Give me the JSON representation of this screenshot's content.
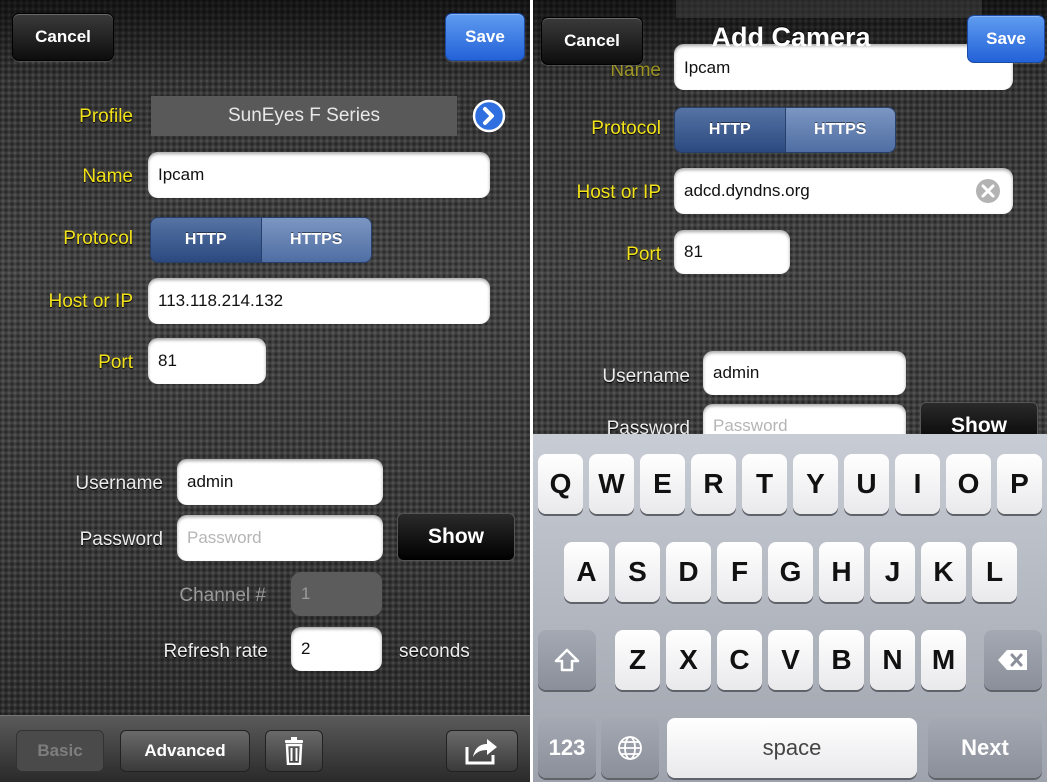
{
  "left": {
    "nav": {
      "cancel": "Cancel",
      "save": "Save"
    },
    "labels": {
      "profile": "Profile",
      "name": "Name",
      "protocol": "Protocol",
      "host": "Host or IP",
      "port": "Port",
      "username": "Username",
      "password": "Password",
      "channel": "Channel #",
      "refresh": "Refresh rate",
      "seconds": "seconds"
    },
    "profile_value": "SunEyes F Series",
    "name_value": "Ipcam",
    "protocol_options": [
      "HTTP",
      "HTTPS"
    ],
    "host_value": "113.118.214.132",
    "port_value": "81",
    "username_value": "admin",
    "password_placeholder": "Password",
    "show_button": "Show",
    "channel_value": "1",
    "refresh_value": "2",
    "toolbar": {
      "basic": "Basic",
      "advanced": "Advanced",
      "trash_icon": "trash-icon",
      "share_icon": "share-icon"
    }
  },
  "right": {
    "nav": {
      "cancel": "Cancel",
      "title": "Add Camera",
      "save": "Save"
    },
    "labels": {
      "name": "Name",
      "protocol": "Protocol",
      "host": "Host or IP",
      "port": "Port",
      "username": "Username",
      "password": "Password"
    },
    "name_value": "Ipcam",
    "protocol_options": [
      "HTTP",
      "HTTPS"
    ],
    "host_value": "adcd.dyndns.org",
    "port_value": "81",
    "username_value": "admin",
    "password_placeholder": "Password",
    "show_button": "Show",
    "keyboard": {
      "row1": [
        "Q",
        "W",
        "E",
        "R",
        "T",
        "Y",
        "U",
        "I",
        "O",
        "P"
      ],
      "row2": [
        "A",
        "S",
        "D",
        "F",
        "G",
        "H",
        "J",
        "K",
        "L"
      ],
      "row3": [
        "Z",
        "X",
        "C",
        "V",
        "B",
        "N",
        "M"
      ],
      "numbers": "123",
      "space": "space",
      "next": "Next"
    }
  },
  "colors": {
    "label_yellow": "#f2e21a",
    "save_blue": "#2f6fe0",
    "segment_blue": "#3d5c93"
  }
}
